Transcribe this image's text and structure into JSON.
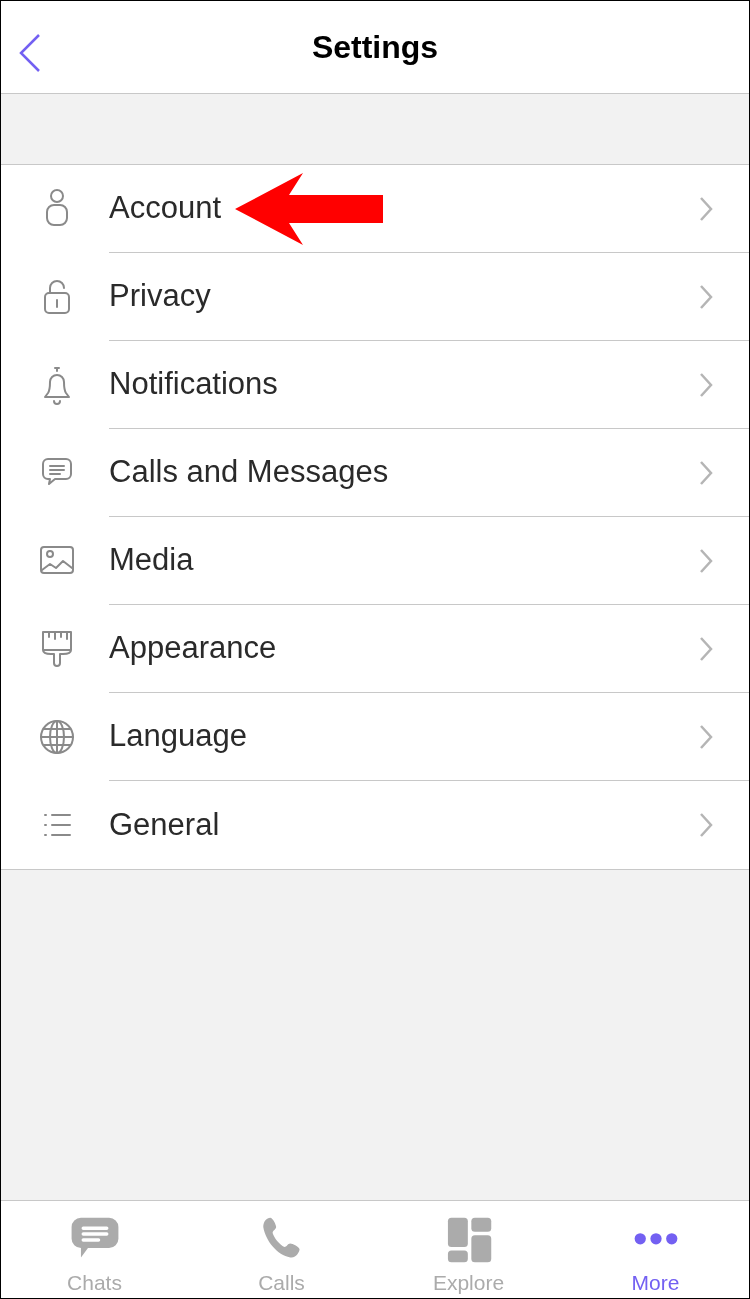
{
  "header": {
    "title": "Settings"
  },
  "rows": [
    {
      "label": "Account",
      "highlighted": true
    },
    {
      "label": "Privacy",
      "highlighted": false
    },
    {
      "label": "Notifications",
      "highlighted": false
    },
    {
      "label": "Calls and Messages",
      "highlighted": false
    },
    {
      "label": "Media",
      "highlighted": false
    },
    {
      "label": "Appearance",
      "highlighted": false
    },
    {
      "label": "Language",
      "highlighted": false
    },
    {
      "label": "General",
      "highlighted": false
    }
  ],
  "tabs": [
    {
      "label": "Chats",
      "selected": false
    },
    {
      "label": "Calls",
      "selected": false
    },
    {
      "label": "Explore",
      "selected": false
    },
    {
      "label": "More",
      "selected": true
    }
  ]
}
